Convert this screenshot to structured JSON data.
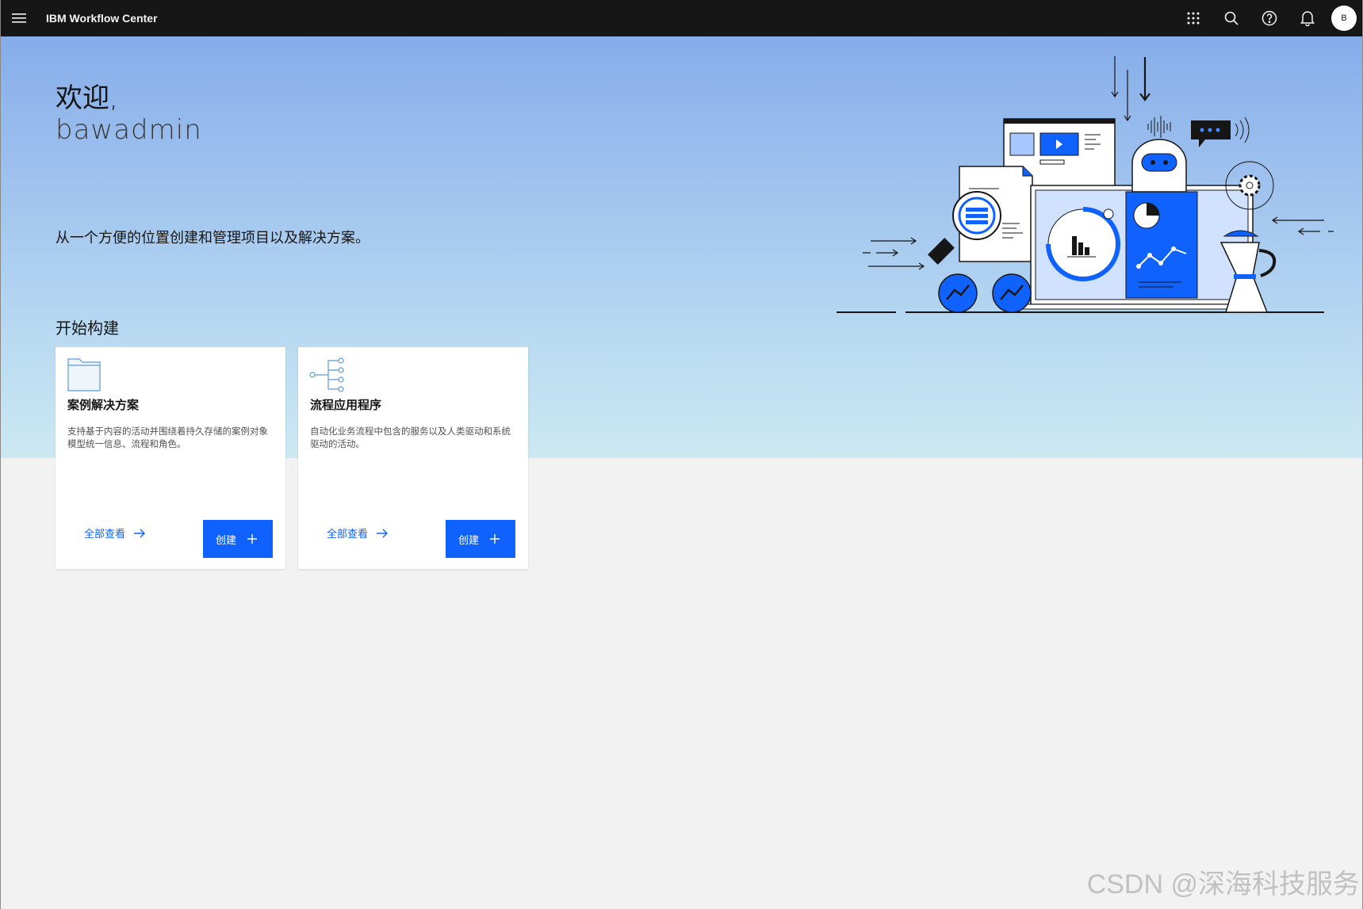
{
  "header": {
    "brand": "IBM Workflow Center",
    "avatar_initial": "B",
    "icons": [
      "menu-icon",
      "app-switcher-icon",
      "search-icon",
      "help-icon",
      "notification-icon"
    ]
  },
  "hero": {
    "welcome": "欢迎,",
    "username": "bawadmin",
    "tagline": "从一个方便的位置创建和管理项目以及解决方案。"
  },
  "section": {
    "title": "开始构建"
  },
  "cards": [
    {
      "icon": "folder-icon",
      "title": "案例解决方案",
      "description": "支持基于内容的活动并围绕着持久存储的案例对象模型统一信息、流程和角色。",
      "view_all": "全部查看",
      "create": "创建"
    },
    {
      "icon": "process-flow-icon",
      "title": "流程应用程序",
      "description": "自动化业务流程中包含的服务以及人类驱动和系统驱动的活动。",
      "view_all": "全部查看",
      "create": "创建"
    }
  ],
  "watermark": "CSDN @深海科技服务",
  "colors": {
    "accent": "#0f62fe",
    "topbar": "#161616",
    "background": "#f2f2f2"
  }
}
